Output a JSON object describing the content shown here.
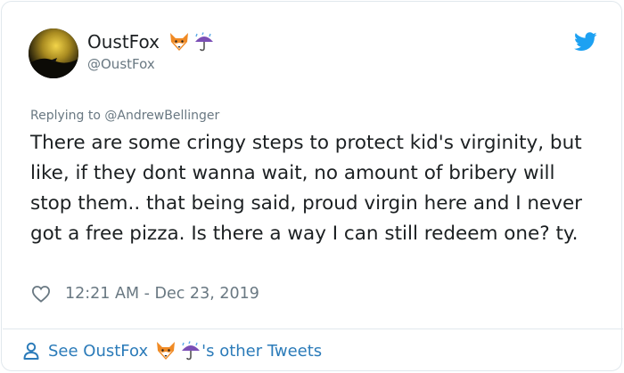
{
  "tweet": {
    "user": {
      "display_name": "OustFox",
      "handle": "@OustFox",
      "name_emojis": [
        "fox-face",
        "umbrella-with-rain"
      ]
    },
    "reply_prefix": "Replying to ",
    "reply_mention": "@AndrewBellinger",
    "text": "There are some cringy steps to protect kid's virginity, but like, if they dont wanna wait, no amount of bribery will stop them.. that being said, proud virgin here and I never got a free pizza. Is there a way I can still redeem one? ty.",
    "timestamp": "12:21 AM - Dec 23, 2019"
  },
  "footer": {
    "see_prefix": "See OustFox",
    "see_suffix": "'s other Tweets"
  },
  "icons": {
    "brand": "twitter-bird-icon",
    "like": "heart-icon",
    "profile": "person-icon"
  },
  "colors": {
    "link": "#2b7bb9",
    "twitter_blue": "#1da1f2",
    "muted": "#697882",
    "text": "#1c2022",
    "border": "#e1e8ed"
  }
}
